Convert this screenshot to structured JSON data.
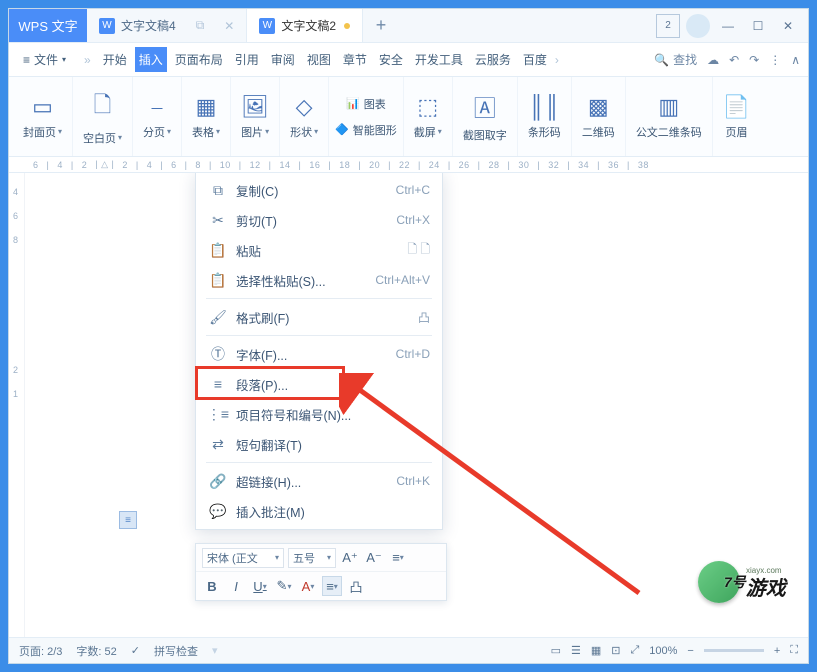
{
  "app_name": "WPS 文字",
  "tabs": [
    {
      "label": "文字文稿4"
    },
    {
      "label": "文字文稿2"
    }
  ],
  "title_indicator": "2",
  "menubar": {
    "file": "文件",
    "items": [
      "开始",
      "插入",
      "页面布局",
      "引用",
      "审阅",
      "视图",
      "章节",
      "安全",
      "开发工具",
      "云服务",
      "百度"
    ],
    "search_label": "查找"
  },
  "toolbar": {
    "cover": "封面页",
    "blank": "空白页",
    "pagebreak": "分页",
    "table": "表格",
    "picture": "图片",
    "shape": "形状",
    "chart": "图表",
    "smartart": "智能图形",
    "screenshot": "截屏",
    "screentext": "截图取字",
    "barcode": "条形码",
    "qrcode": "二维码",
    "officialdoc": "公文二维条码",
    "header": "页眉"
  },
  "ruler": [
    "6",
    "4",
    "2",
    "2",
    "4",
    "6",
    "8",
    "10",
    "12",
    "14",
    "16",
    "18",
    "20",
    "22",
    "24",
    "26",
    "28",
    "30",
    "32",
    "34",
    "36",
    "38"
  ],
  "vruler": [
    "4",
    "6",
    "8",
    "2",
    "1"
  ],
  "context_menu": {
    "copy": {
      "label": "复制(C)",
      "shortcut": "Ctrl+C"
    },
    "cut": {
      "label": "剪切(T)",
      "shortcut": "Ctrl+X"
    },
    "paste": {
      "label": "粘贴",
      "shortcut": ""
    },
    "paste_special": {
      "label": "选择性粘贴(S)...",
      "shortcut": "Ctrl+Alt+V"
    },
    "format_painter": {
      "label": "格式刷(F)",
      "shortcut": ""
    },
    "font": {
      "label": "字体(F)...",
      "shortcut": "Ctrl+D"
    },
    "paragraph": {
      "label": "段落(P)...",
      "shortcut": ""
    },
    "bullets": {
      "label": "项目符号和编号(N)...",
      "shortcut": ""
    },
    "translate": {
      "label": "短句翻译(T)",
      "shortcut": ""
    },
    "hyperlink": {
      "label": "超链接(H)...",
      "shortcut": "Ctrl+K"
    },
    "comment": {
      "label": "插入批注(M)",
      "shortcut": ""
    }
  },
  "mini_toolbar": {
    "font_name": "宋体 (正文",
    "font_size": "五号"
  },
  "statusbar": {
    "page": "页面: 2/3",
    "wordcount": "字数: 52",
    "spellcheck": "拼写检查",
    "zoom": "100%"
  },
  "watermark": {
    "main": "游戏",
    "sub": "xiayx.com",
    "brand": "7号"
  }
}
